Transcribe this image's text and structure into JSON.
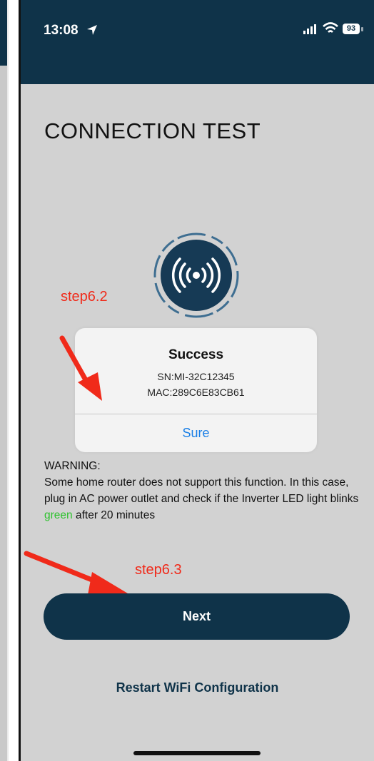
{
  "status_bar": {
    "time": "13:08",
    "battery": "93"
  },
  "page": {
    "title": "CONNECTION TEST"
  },
  "annotations": {
    "step_a": "step6.2",
    "step_b": "step6.3"
  },
  "dialog": {
    "title": "Success",
    "sn": "SN:MI-32C12345",
    "mac": "MAC:289C6E83CB61",
    "button": "Sure"
  },
  "warning": {
    "heading": "WARNING:",
    "text_before": "Some home router does not support this function. In this case, plug in AC power outlet and check if the Inverter LED light blinks ",
    "highlight": "green",
    "text_after": " after 20 minutes"
  },
  "buttons": {
    "next": "Next",
    "restart": "Restart WiFi Configuration"
  },
  "colors": {
    "header": "#0f3349",
    "background": "#d2d2d2",
    "annotation": "#f02a1a",
    "link": "#1a7fe6",
    "success_green": "#2ec22e"
  }
}
